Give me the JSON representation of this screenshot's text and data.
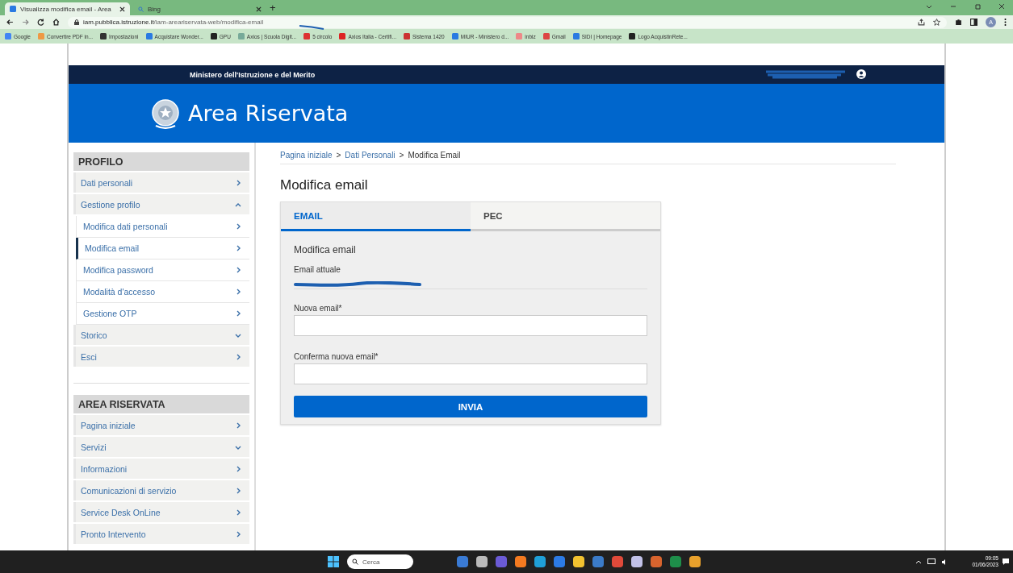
{
  "browser": {
    "tabs": [
      {
        "title": "Visualizza modifica email - Area",
        "selected": true,
        "kind": "site"
      },
      {
        "title": "Bing",
        "selected": false,
        "kind": "search"
      }
    ],
    "new_tab": "+",
    "address": {
      "host": "iam.pubblica.istruzione.it",
      "path": "/iam-areariservata-web/modifica-email"
    },
    "profile_initial": "A",
    "bookmarks": [
      "Google",
      "Convertire PDF in...",
      "Impostazioni",
      "Acquistare Wonder...",
      "GPU",
      "Axios | Scuola Digit...",
      "5 circolo",
      "Axios Italia - Certifi...",
      "Sistema 1420",
      "MIUR - Ministero d...",
      "inbiz",
      "Gmail",
      "SIDI | Homepage",
      "Logo AcquistinRete..."
    ]
  },
  "site": {
    "ministry": "Ministero dell'Istruzione e del Merito",
    "title": "Area Riservata"
  },
  "sidebar": {
    "sections": [
      {
        "title": "PROFILO",
        "items": [
          {
            "label": "Dati personali",
            "kind": "link"
          },
          {
            "label": "Gestione profilo",
            "kind": "group",
            "expanded": true,
            "children": [
              {
                "label": "Modifica dati personali",
                "selected": false
              },
              {
                "label": "Modifica email",
                "selected": true
              },
              {
                "label": "Modifica password",
                "selected": false
              },
              {
                "label": "Modalità d'accesso",
                "selected": false
              },
              {
                "label": "Gestione OTP",
                "selected": false
              }
            ]
          },
          {
            "label": "Storico",
            "kind": "group",
            "expanded": false
          },
          {
            "label": "Esci",
            "kind": "link"
          }
        ]
      },
      {
        "title": "AREA RISERVATA",
        "items": [
          {
            "label": "Pagina iniziale",
            "kind": "link"
          },
          {
            "label": "Servizi",
            "kind": "group",
            "expanded": false
          },
          {
            "label": "Informazioni",
            "kind": "link"
          },
          {
            "label": "Comunicazioni di servizio",
            "kind": "link"
          },
          {
            "label": "Service Desk OnLine",
            "kind": "link"
          },
          {
            "label": "Pronto Intervento",
            "kind": "link"
          }
        ]
      }
    ]
  },
  "breadcrumb": {
    "links": [
      "Pagina iniziale",
      "Dati Personali"
    ],
    "separator": ">",
    "current": "Modifica Email"
  },
  "page_title": "Modifica email",
  "form_tabs": [
    {
      "label": "EMAIL",
      "selected": true
    },
    {
      "label": "PEC",
      "selected": false
    }
  ],
  "form": {
    "heading": "Modifica email",
    "current_label": "Email attuale",
    "fields": [
      {
        "label": "Nuova email*"
      },
      {
        "label": "Conferma nuova email*"
      }
    ],
    "submit": "INVIA"
  },
  "taskbar": {
    "search_placeholder": "Cerca",
    "time": "09:05",
    "date": "01/06/2023"
  }
}
